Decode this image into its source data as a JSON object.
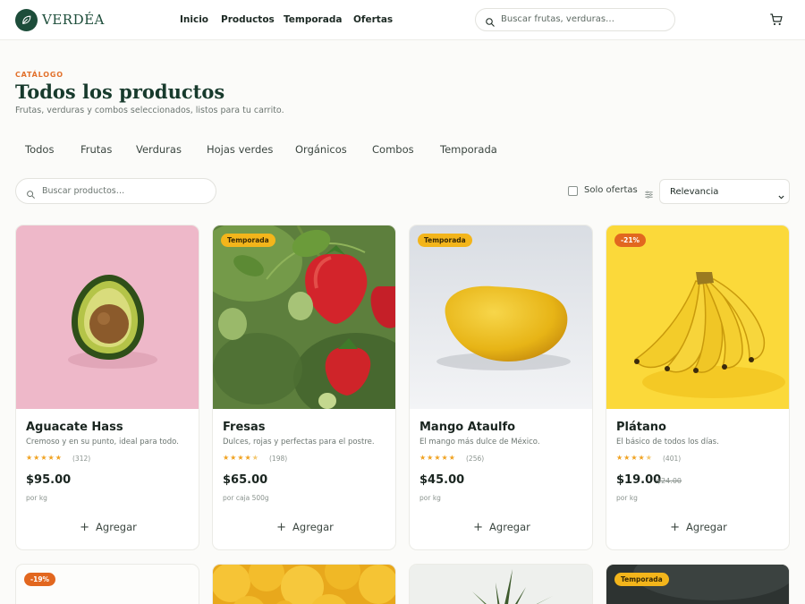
{
  "brand": {
    "name": "VERDÉA"
  },
  "nav": [
    "Inicio",
    "Productos",
    "Temporada",
    "Ofertas"
  ],
  "header_search": {
    "placeholder": "Buscar frutas, verduras…"
  },
  "catalog": {
    "eyebrow": "CATÁLOGO",
    "title": "Todos los productos",
    "subtitle": "Frutas, verduras y combos seleccionados, listos para tu carrito."
  },
  "tabs": [
    "Todos",
    "Frutas",
    "Verduras",
    "Hojas verdes",
    "Orgánicos",
    "Combos",
    "Temporada"
  ],
  "filters": {
    "search_placeholder": "Buscar productos…",
    "offers_only_label": "Solo ofertas",
    "offers_only_checked": false,
    "sort_value": "Relevancia"
  },
  "products": [
    {
      "name": "Aguacate Hass",
      "desc": "Cremoso y en su punto, ideal para todo.",
      "rating": 5,
      "reviews": "(312)",
      "price": "$95.00",
      "old_price": "",
      "unit": "por kg",
      "badge": "",
      "add_label": "Agregar",
      "image": "avocado"
    },
    {
      "name": "Fresas",
      "desc": "Dulces, rojas y perfectas para el postre.",
      "rating": 4.5,
      "reviews": "(198)",
      "price": "$65.00",
      "old_price": "",
      "unit": "por caja 500g",
      "badge": "Temporada",
      "add_label": "Agregar",
      "image": "strawberries"
    },
    {
      "name": "Mango Ataulfo",
      "desc": "El mango más dulce de México.",
      "rating": 5,
      "reviews": "(256)",
      "price": "$45.00",
      "old_price": "",
      "unit": "por kg",
      "badge": "Temporada",
      "add_label": "Agregar",
      "image": "mango"
    },
    {
      "name": "Plátano",
      "desc": "El básico de todos los días.",
      "rating": 4.5,
      "reviews": "(401)",
      "price": "$19.00",
      "old_price": "$24.00",
      "unit": "por kg",
      "badge": "-21%",
      "add_label": "Agregar",
      "image": "banana"
    }
  ],
  "second_row_badges": [
    "-19%",
    "",
    "",
    "Temporada"
  ],
  "colors": {
    "brand": "#1d4d3a",
    "accent": "#e2712c",
    "season_badge": "#f3b51b",
    "discount_badge": "#e2671f",
    "stars": "#f0a220"
  },
  "icons": [
    "leaf-icon",
    "search-icon",
    "cart-icon",
    "sort-icon",
    "chevron-down-icon",
    "plus-icon",
    "star-icon"
  ]
}
